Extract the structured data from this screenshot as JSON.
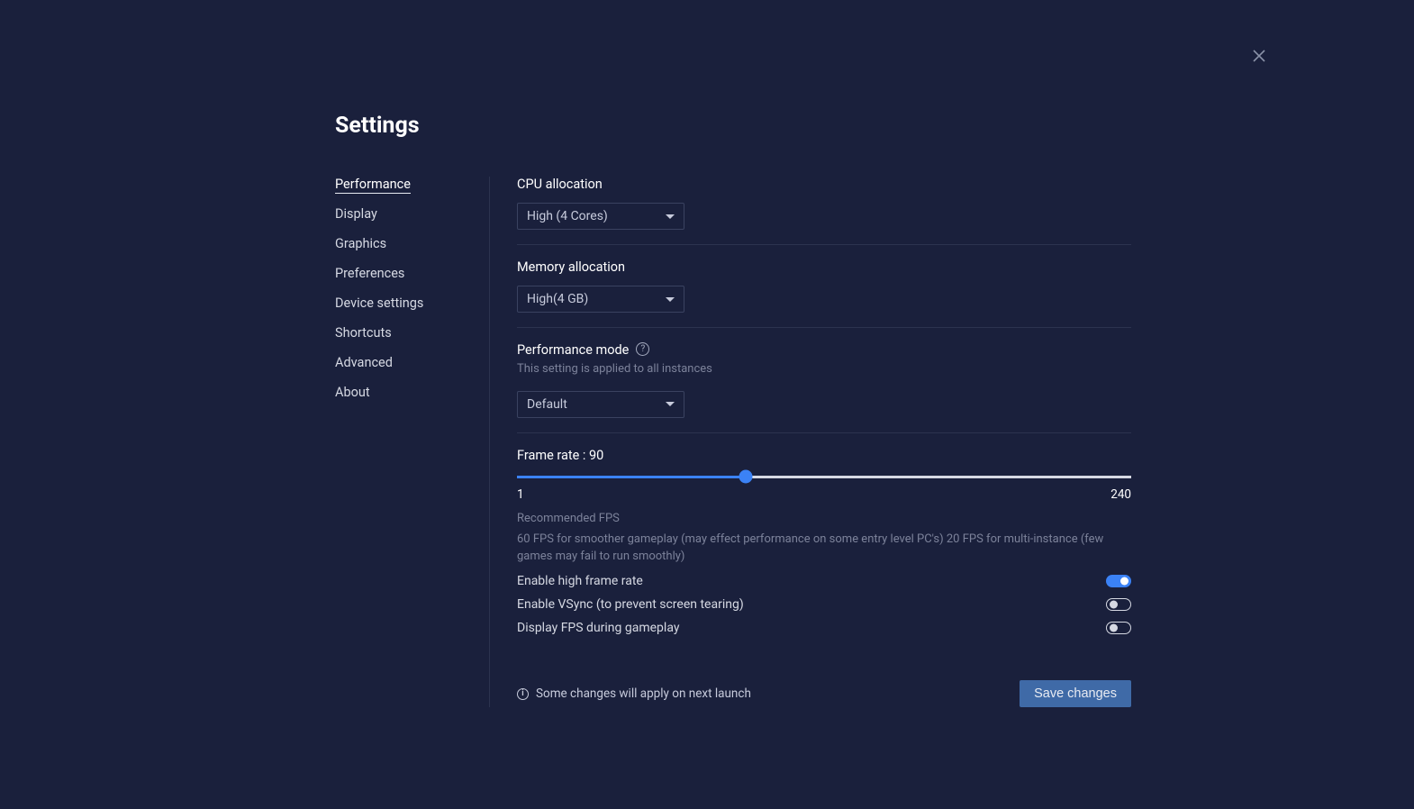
{
  "title": "Settings",
  "sidebar": [
    {
      "label": "Performance",
      "active": true
    },
    {
      "label": "Display",
      "active": false
    },
    {
      "label": "Graphics",
      "active": false
    },
    {
      "label": "Preferences",
      "active": false
    },
    {
      "label": "Device settings",
      "active": false
    },
    {
      "label": "Shortcuts",
      "active": false
    },
    {
      "label": "Advanced",
      "active": false
    },
    {
      "label": "About",
      "active": false
    }
  ],
  "cpu": {
    "label": "CPU allocation",
    "value": "High (4 Cores)"
  },
  "memory": {
    "label": "Memory allocation",
    "value": "High(4 GB)"
  },
  "perfMode": {
    "label": "Performance mode",
    "hint": "This setting is applied to all instances",
    "value": "Default"
  },
  "frameRate": {
    "label": "Frame rate : 90",
    "value": 90,
    "min": "1",
    "max": "240",
    "recTitle": "Recommended FPS",
    "recText": "60 FPS for smoother gameplay (may effect performance on some entry level PC's) 20 FPS for multi-instance (few games may fail to run smoothly)"
  },
  "toggles": {
    "highFrame": {
      "label": "Enable high frame rate",
      "on": true
    },
    "vsync": {
      "label": "Enable VSync (to prevent screen tearing)",
      "on": false
    },
    "fps": {
      "label": "Display FPS during gameplay",
      "on": false
    }
  },
  "footer": {
    "notice": "Some changes will apply on next launch",
    "save": "Save changes"
  }
}
